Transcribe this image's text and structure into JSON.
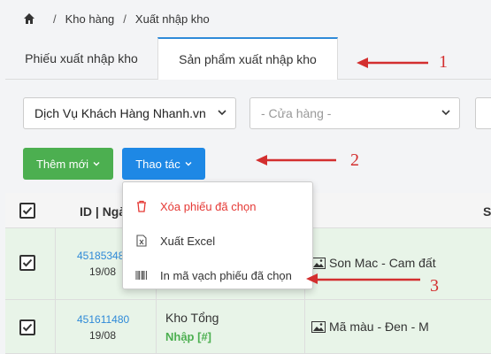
{
  "breadcrumb": {
    "items": [
      "Kho hàng",
      "Xuất nhập kho"
    ]
  },
  "tabs": {
    "tab1": "Phiếu xuất nhập kho",
    "tab2": "Sản phẩm xuất nhập kho"
  },
  "filters": {
    "store_group": "Dịch Vụ Khách Hàng Nhanh.vn",
    "store_placeholder": "- Cửa hàng -"
  },
  "toolbar": {
    "add_label": "Thêm mới",
    "actions_label": "Thao tác"
  },
  "menu": {
    "delete": "Xóa phiếu đã chọn",
    "export": "Xuất Excel",
    "print": "In mã vạch phiếu đã chọn"
  },
  "table": {
    "header_id": "ID | Ngà",
    "header_s": "S",
    "rows": [
      {
        "id": "45185348",
        "date": "19/08",
        "product": "Son Mac - Cam đất"
      },
      {
        "id": "451611480",
        "date": "19/08",
        "warehouse": "Kho Tổng",
        "type": "Nhập [#]",
        "product": "Mã màu - Đen - M"
      }
    ]
  },
  "annotations": [
    "1",
    "2",
    "3"
  ],
  "colors": {
    "accent": "#2f8ad8",
    "add_button": "#4caf50",
    "actions_button": "#1e88e5",
    "delete": "#e53935",
    "annotation": "#d32f2f",
    "selected_row": "#e8f4e8"
  }
}
